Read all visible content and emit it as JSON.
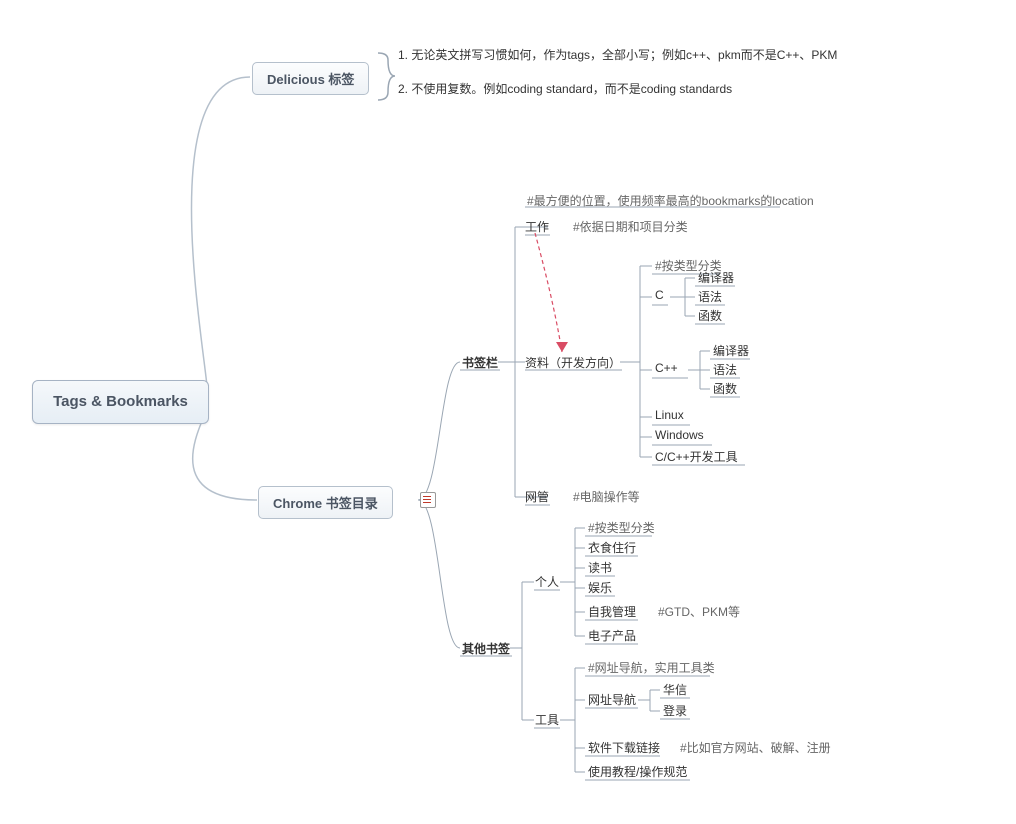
{
  "root": "Tags & Bookmarks",
  "delicious": {
    "label": "Delicious 标签",
    "rule1": "1. 无论英文拼写习惯如何，作为tags，全部小写；例如c++、pkm而不是C++、PKM",
    "rule2": "2. 不使用复数。例如coding standard，而不是coding standards"
  },
  "chrome": {
    "label": "Chrome 书签目录",
    "bookmarkBar": {
      "label": "书签栏",
      "topNote": "#最方便的位置，使用频率最高的bookmarks的location",
      "work": {
        "label": "工作",
        "note": "#依据日期和项目分类"
      },
      "resources": {
        "label": "资料（开发方向）",
        "byType": "#按类型分类",
        "c": {
          "label": "C",
          "compiler": "编译器",
          "grammar": "语法",
          "func": "函数"
        },
        "cpp": {
          "label": "C++",
          "compiler": "编译器",
          "grammar": "语法",
          "func": "函数"
        },
        "linux": "Linux",
        "windows": "Windows",
        "devtools": "C/C++开发工具"
      },
      "netadmin": {
        "label": "网管",
        "note": "#电脑操作等"
      }
    },
    "other": {
      "label": "其他书签",
      "personal": {
        "label": "个人",
        "byType": "#按类型分类",
        "life": "衣食住行",
        "reading": "读书",
        "entertain": "娱乐",
        "selfmgmt": {
          "label": "自我管理",
          "note": "#GTD、PKM等"
        },
        "electronics": "电子产品"
      },
      "tools": {
        "label": "工具",
        "note": "#网址导航，实用工具类",
        "nav": {
          "label": "网址导航",
          "huaxin": "华信",
          "login": "登录"
        },
        "download": {
          "label": "软件下载链接",
          "note": "#比如官方网站、破解、注册"
        },
        "tutorial": "使用教程/操作规范"
      }
    }
  }
}
